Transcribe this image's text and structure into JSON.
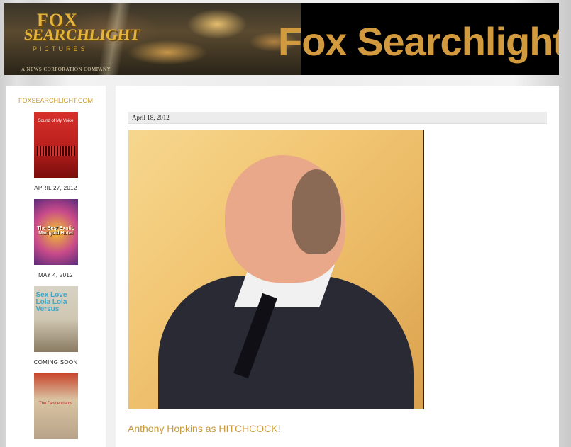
{
  "header": {
    "logo_top": "FOX",
    "logo_main": "SEARCHLIGHT",
    "logo_pictures": "PICTURES",
    "logo_sub": "A NEWS CORPORATION COMPANY",
    "brand_title": "Fox Searchlight",
    "brand_color": "#d29a3e"
  },
  "sidebar": {
    "link": "FOXSEARCHLIGHT.COM",
    "posters": [
      {
        "title": "Sound of My Voice",
        "caption": "APRIL 27, 2012"
      },
      {
        "title": "The Best Exotic Marigold Hotel",
        "caption": "MAY 4, 2012"
      },
      {
        "title": "Sex Love Lola Lola Versus",
        "caption": "COMING SOON"
      },
      {
        "title": "The Descendants",
        "caption": ""
      }
    ]
  },
  "post": {
    "date": "April 18, 2012",
    "caption_link": "Anthony Hopkins as HITCHCOCK",
    "caption_tail": "!",
    "link_color": "#c79a3a"
  }
}
